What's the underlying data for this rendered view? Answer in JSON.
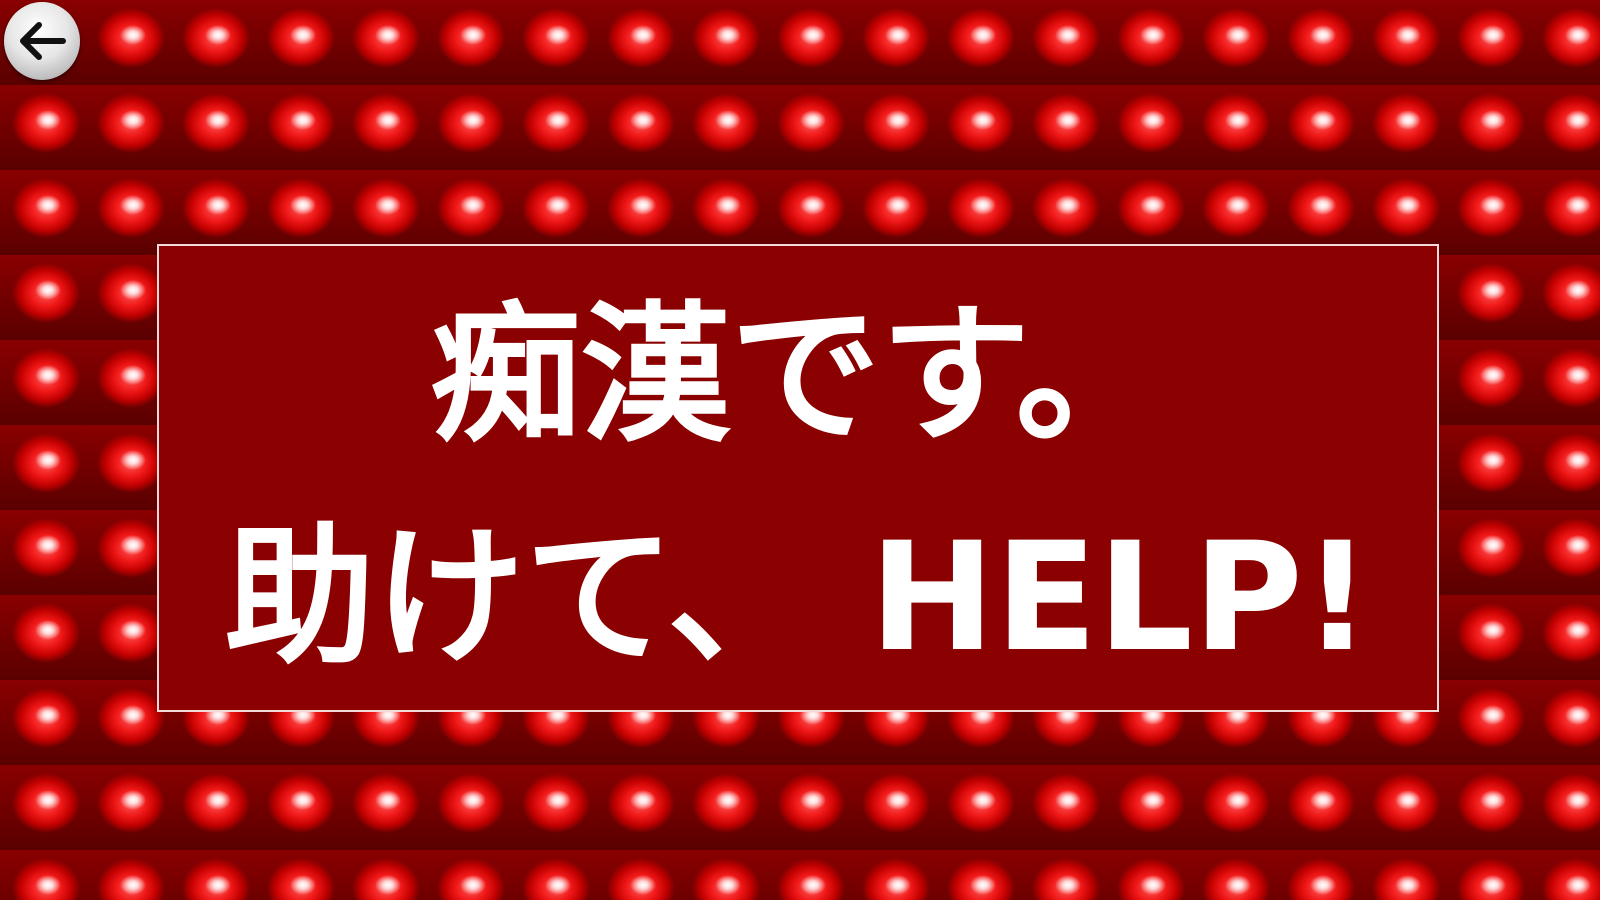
{
  "screen": {
    "message_line_1": "痴漢です。",
    "message_line_2": "助けて、 HELP!"
  },
  "icons": {
    "back": "arrow-left-icon",
    "background_tile": "red-warning-light-icon"
  },
  "colors": {
    "panel_background": "#8b0000",
    "panel_border": "#f3dada",
    "light_red": "#f01818",
    "text": "#ffffff",
    "back_button": "#e6e6e6"
  }
}
